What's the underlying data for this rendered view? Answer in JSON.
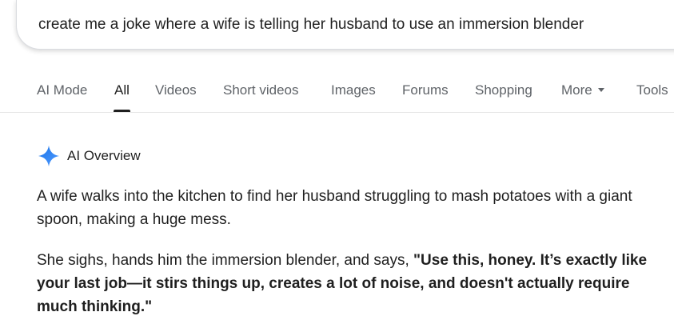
{
  "search": {
    "query": "create me a joke where a wife is telling her husband to use an immersion blender"
  },
  "tabs": [
    {
      "label": "AI Mode",
      "active": false
    },
    {
      "label": "All",
      "active": true
    },
    {
      "label": "Videos",
      "active": false
    },
    {
      "label": "Short videos",
      "active": false
    },
    {
      "label": "Images",
      "active": false
    },
    {
      "label": "Forums",
      "active": false
    },
    {
      "label": "Shopping",
      "active": false
    },
    {
      "label": "More",
      "active": false
    },
    {
      "label": "Tools",
      "active": false
    }
  ],
  "ai_overview": {
    "icon": "sparkle-icon",
    "title": "AI Overview",
    "paragraph1": "A wife walks into the kitchen to find her husband struggling to mash potatoes with a giant spoon, making a huge mess.",
    "paragraph2_intro": "She sighs, hands him the immersion blender, and says, ",
    "paragraph2_quote": "\"Use this, honey. It’s exactly like your last job—it stirs things up, creates a lot of noise, and doesn't actually require much thinking.\""
  },
  "colors": {
    "sparkle": "#4285f4",
    "tab_inactive": "#5f6368",
    "text": "#1f1f1f"
  }
}
